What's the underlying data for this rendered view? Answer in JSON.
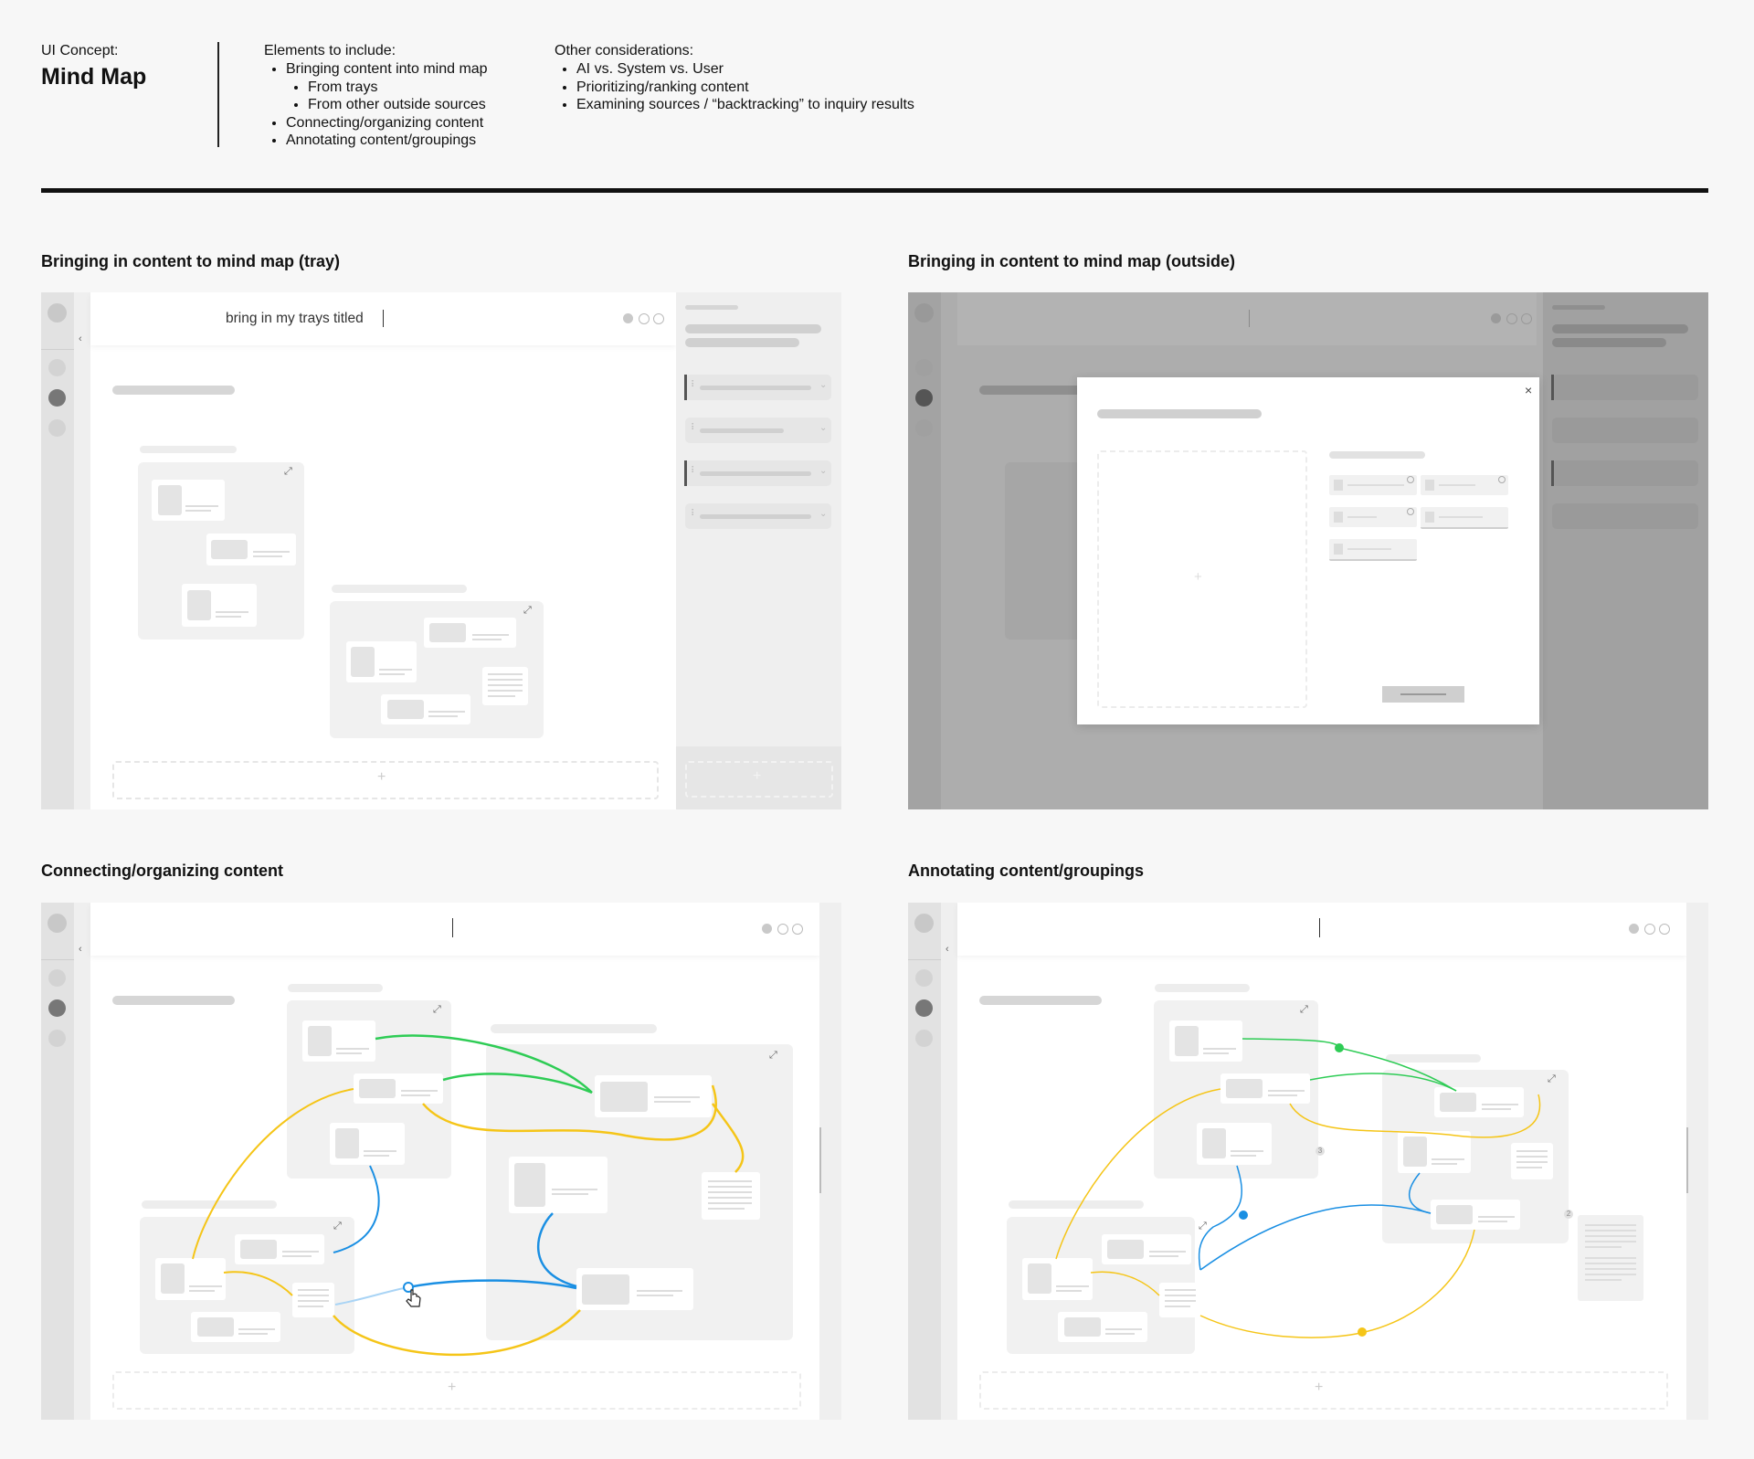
{
  "header": {
    "concept_label": "UI Concept:",
    "concept_title": "Mind Map",
    "elements": {
      "title": "Elements to include:",
      "items": [
        "Bringing content into mind map",
        "From trays",
        "From other outside sources",
        "Connecting/organizing content",
        "Annotating content/groupings"
      ]
    },
    "considerations": {
      "title": "Other considerations:",
      "items": [
        "AI vs. System vs. User",
        "Prioritizing/ranking content",
        "Examining sources / “backtracking” to inquiry results"
      ]
    }
  },
  "sections": [
    {
      "title": "Bringing in content to mind map (tray)",
      "search_text": "bring in my trays titled"
    },
    {
      "title": "Bringing in content to mind map (outside)"
    },
    {
      "title": "Connecting/organizing content"
    },
    {
      "title": "Annotating content/groupings"
    }
  ],
  "icons": {
    "collapse": "‹",
    "expand": "⤢",
    "close": "×",
    "add": "+",
    "drag": "⠇",
    "chevron": "⌄",
    "cursor": "hand-pointer-icon"
  },
  "annotation_badges": [
    "3",
    "2"
  ],
  "colors": {
    "green": "#2ecc55",
    "yellow": "#f5c518",
    "blue": "#1a8fe3",
    "light_blue": "#a9d4f5"
  }
}
